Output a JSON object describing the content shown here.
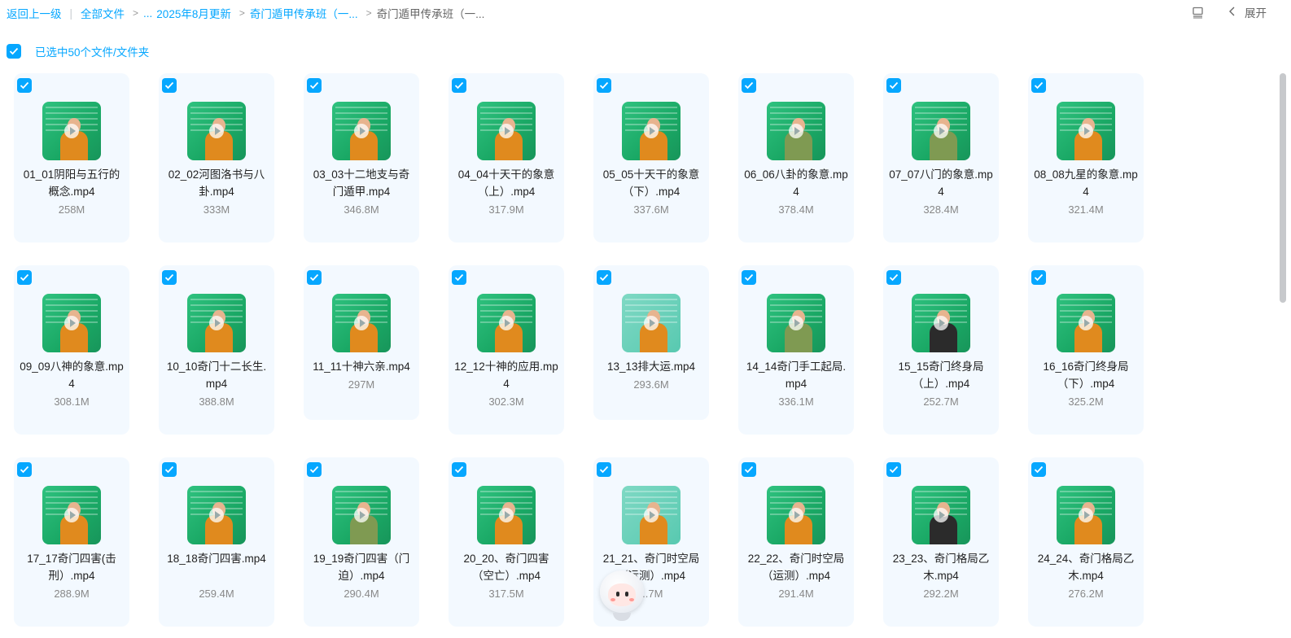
{
  "breadcrumb": {
    "back": "返回上一级",
    "all_files": "全部文件",
    "ellipsis": "...",
    "level1": "2025年8月更新",
    "level2": "奇门遁甲传承班（一...",
    "current": "奇门遁甲传承班（一..."
  },
  "toolbar": {
    "expand_label": "展开",
    "list_icon": "list-view-icon",
    "chevron_icon": "chevron-left-icon"
  },
  "selection": {
    "text": "已选中50个文件/文件夹"
  },
  "colors": {
    "accent": "#06a7ff",
    "card_bg": "#f3f9ff",
    "thumb_green": "#1aa865"
  },
  "files": [
    {
      "name": "01_01阴阳与五行的概念.mp4",
      "size": "258M"
    },
    {
      "name": "02_02河图洛书与八卦.mp4",
      "size": "333M"
    },
    {
      "name": "03_03十二地支与奇门遁甲.mp4",
      "size": "346.8M"
    },
    {
      "name": "04_04十天干的象意（上）.mp4",
      "size": "317.9M"
    },
    {
      "name": "05_05十天干的象意（下）.mp4",
      "size": "337.6M"
    },
    {
      "name": "06_06八卦的象意.mp4",
      "size": "378.4M"
    },
    {
      "name": "07_07八门的象意.mp4",
      "size": "328.4M"
    },
    {
      "name": "08_08九星的象意.mp4",
      "size": "321.4M"
    },
    {
      "name": "09_09八神的象意.mp4",
      "size": "308.1M"
    },
    {
      "name": "10_10奇门十二长生.mp4",
      "size": "388.8M"
    },
    {
      "name": "11_11十神六亲.mp4",
      "size": "297M"
    },
    {
      "name": "12_12十神的应用.mp4",
      "size": "302.3M"
    },
    {
      "name": "13_13排大运.mp4",
      "size": "293.6M"
    },
    {
      "name": "14_14奇门手工起局.mp4",
      "size": "336.1M"
    },
    {
      "name": "15_15奇门终身局（上）.mp4",
      "size": "252.7M"
    },
    {
      "name": "16_16奇门终身局（下）.mp4",
      "size": "325.2M"
    },
    {
      "name": "17_17奇门四害(击刑）.mp4",
      "size": "288.9M"
    },
    {
      "name": "18_18奇门四害.mp4",
      "size": "259.4M"
    },
    {
      "name": "19_19奇门四害（门迫）.mp4",
      "size": "290.4M"
    },
    {
      "name": "20_20、奇门四害（空亡）.mp4",
      "size": "317.5M"
    },
    {
      "name": "21_21、奇门时空局（运测）.mp4",
      "size": "...7M"
    },
    {
      "name": "22_22、奇门时空局（运测）.mp4",
      "size": "291.4M"
    },
    {
      "name": "23_23、奇门格局乙木.mp4",
      "size": "292.2M"
    },
    {
      "name": "24_24、奇门格局乙木.mp4",
      "size": "276.2M"
    }
  ]
}
